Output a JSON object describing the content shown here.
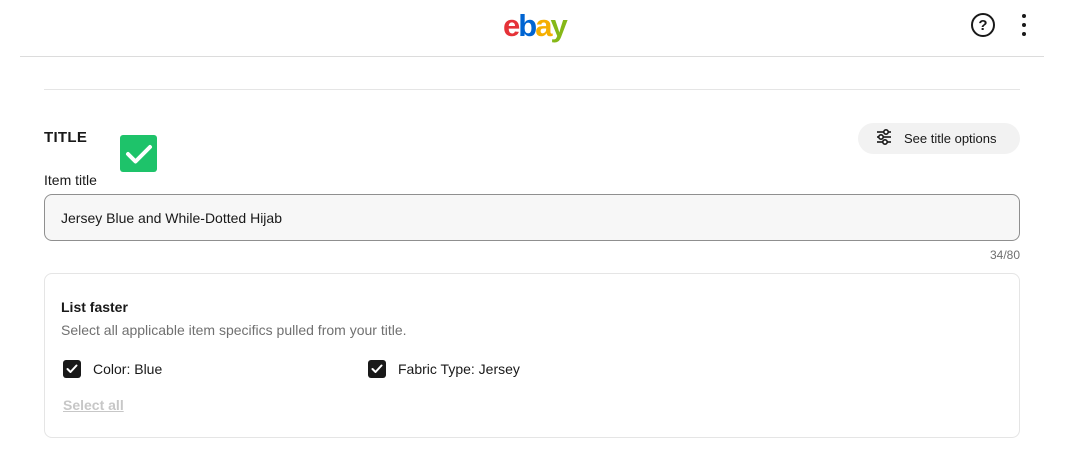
{
  "header": {
    "logo": {
      "e": "e",
      "b": "b",
      "a": "a",
      "y": "y"
    },
    "help_symbol": "?",
    "icons": {
      "help": "help-circle-icon",
      "more": "more-vertical-icon"
    }
  },
  "title_section": {
    "heading": "TITLE",
    "options_button_label": "See title options",
    "field_label": "Item title",
    "input_value": "Jersey Blue and While-Dotted Hijab",
    "char_count": "34/80"
  },
  "list_faster": {
    "title": "List faster",
    "subtitle": "Select all applicable item specifics pulled from your title.",
    "options": [
      {
        "label": "Color: Blue",
        "checked": true
      },
      {
        "label": "Fabric Type: Jersey",
        "checked": true
      }
    ],
    "select_all_label": "Select all"
  },
  "colors": {
    "success_green": "#1ec36a",
    "checkbox": "#191919",
    "disabled_link": "#c7c7c7"
  }
}
